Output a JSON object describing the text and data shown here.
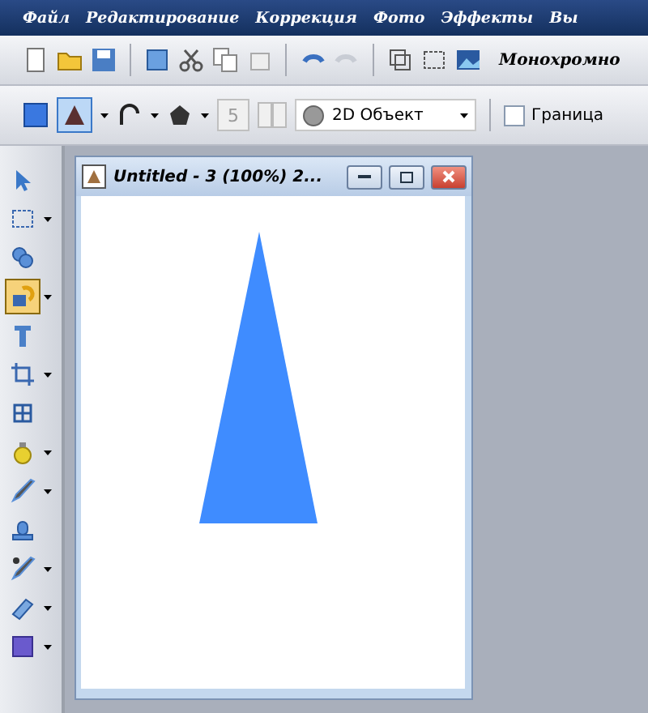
{
  "menu": [
    {
      "label": "Файл"
    },
    {
      "label": "Редактирование"
    },
    {
      "label": "Коррекция"
    },
    {
      "label": "Фото"
    },
    {
      "label": "Эффекты"
    },
    {
      "label": "Вы"
    }
  ],
  "toolbar": {
    "label": "Монохромно"
  },
  "options": {
    "shape_selected": true,
    "size": "5",
    "object_type": "2D Объект",
    "border": {
      "label": "Граница",
      "checked": false
    }
  },
  "tools": [
    {
      "selected": false,
      "dropdown": false
    },
    {
      "selected": false,
      "dropdown": true
    },
    {
      "selected": false,
      "dropdown": false
    },
    {
      "selected": true,
      "dropdown": true
    },
    {
      "selected": false,
      "dropdown": false
    },
    {
      "selected": false,
      "dropdown": true
    },
    {
      "selected": false,
      "dropdown": false
    },
    {
      "selected": false,
      "dropdown": true
    },
    {
      "selected": false,
      "dropdown": true
    },
    {
      "selected": false,
      "dropdown": false
    },
    {
      "selected": false,
      "dropdown": true
    },
    {
      "selected": false,
      "dropdown": true
    },
    {
      "selected": false,
      "dropdown": true
    }
  ],
  "document": {
    "title": "Untitled - 3 (100%) 2..."
  }
}
